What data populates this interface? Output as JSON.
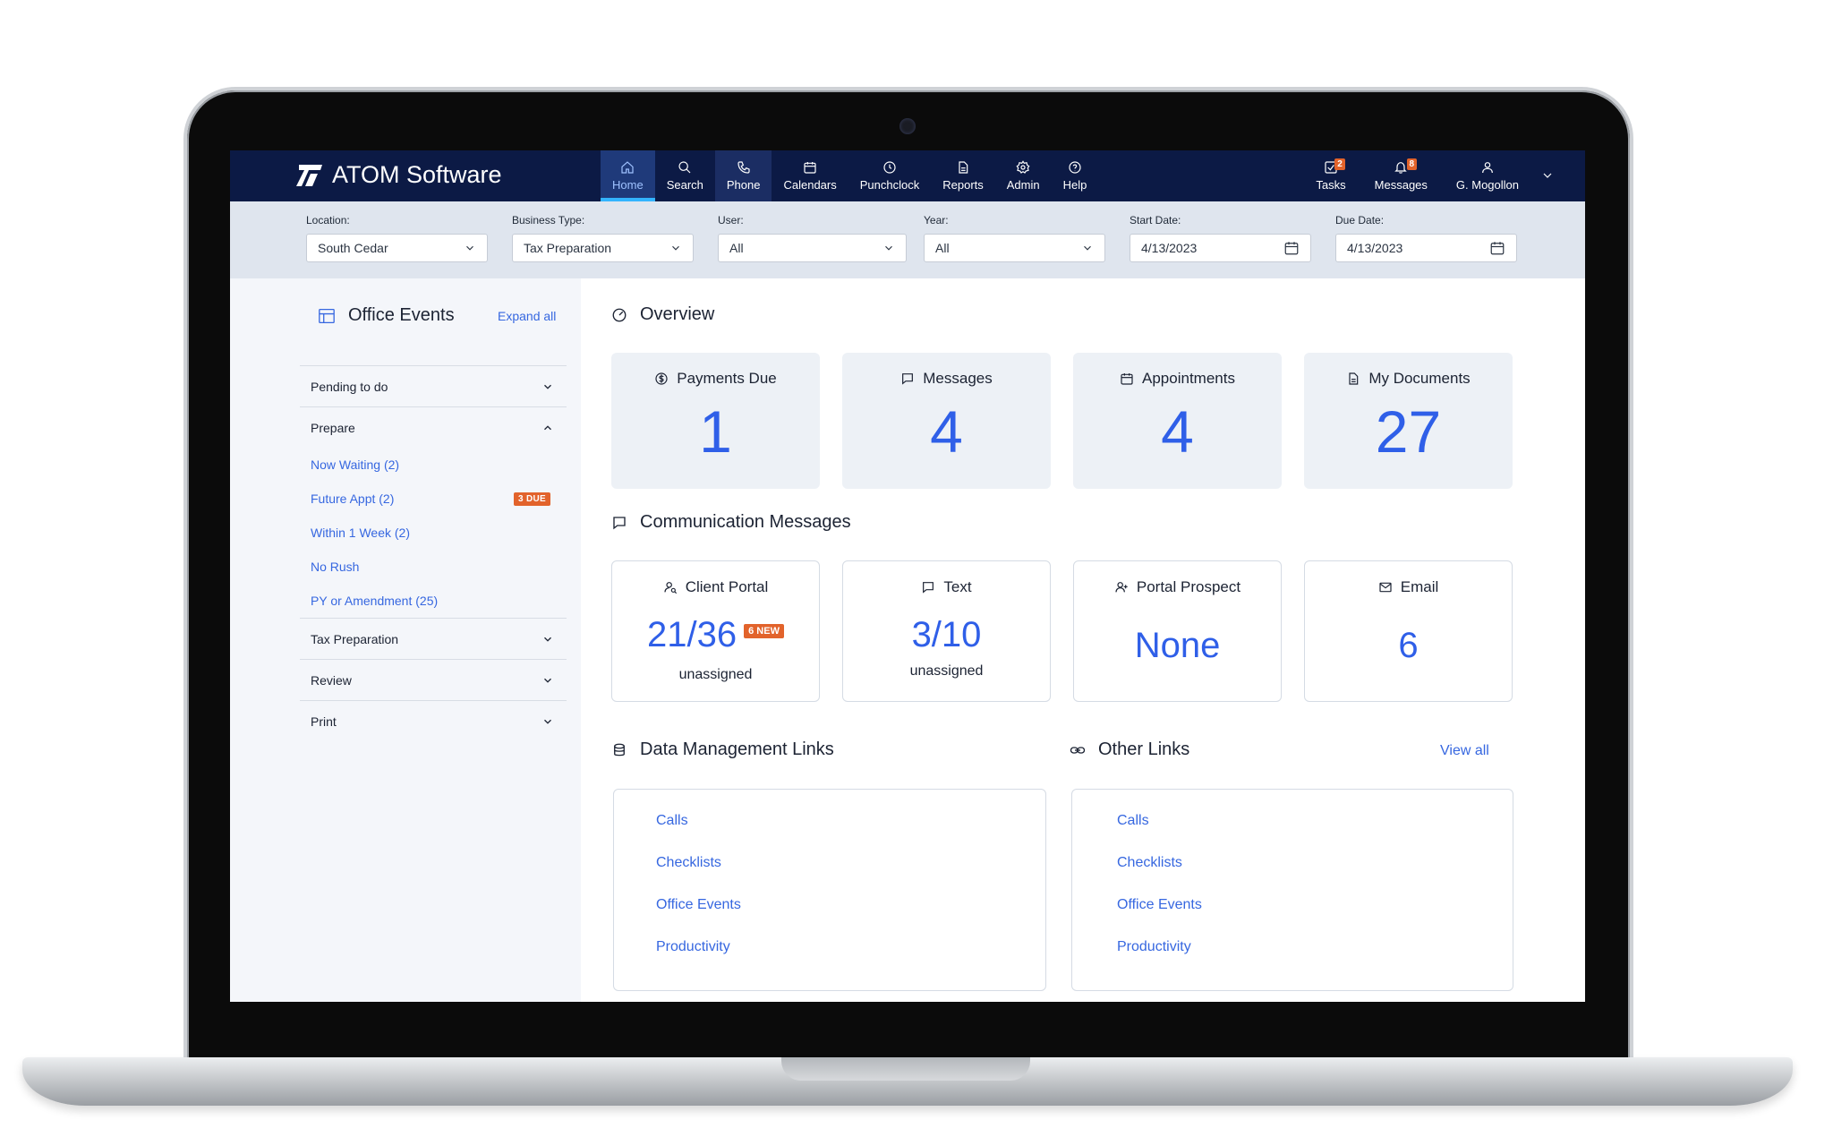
{
  "app": {
    "brand": "ATOM Software"
  },
  "nav": {
    "items": [
      {
        "label": "Home",
        "icon": "home-icon"
      },
      {
        "label": "Search",
        "icon": "search-icon"
      },
      {
        "label": "Phone",
        "icon": "phone-icon"
      },
      {
        "label": "Calendars",
        "icon": "calendar-icon"
      },
      {
        "label": "Punchclock",
        "icon": "clock-icon"
      },
      {
        "label": "Reports",
        "icon": "report-icon"
      },
      {
        "label": "Admin",
        "icon": "gear-icon"
      },
      {
        "label": "Help",
        "icon": "help-icon"
      }
    ],
    "right": {
      "tasks": {
        "label": "Tasks",
        "count": "2"
      },
      "messages": {
        "label": "Messages",
        "count": "8"
      },
      "user": {
        "label": "G. Mogollon"
      }
    }
  },
  "filters": {
    "location": {
      "label": "Location:",
      "value": "South Cedar"
    },
    "business_type": {
      "label": "Business Type:",
      "value": "Tax Preparation"
    },
    "user": {
      "label": "User:",
      "value": "All"
    },
    "year": {
      "label": "Year:",
      "value": "All"
    },
    "start_date": {
      "label": "Start Date:",
      "value": "4/13/2023"
    },
    "due_date": {
      "label": "Due Date:",
      "value": "4/13/2023"
    }
  },
  "office_events": {
    "title": "Office Events",
    "expand_all": "Expand all",
    "sections": {
      "pending": "Pending to do",
      "prepare": "Prepare",
      "tax_preparation": "Tax Preparation",
      "review": "Review",
      "print": "Print"
    },
    "prepare_items": [
      {
        "label": "Now Waiting (2)"
      },
      {
        "label": "Future Appt (2)",
        "badge": "3 DUE"
      },
      {
        "label": "Within 1 Week (2)"
      },
      {
        "label": "No Rush"
      },
      {
        "label": "PY or Amendment (25)"
      }
    ]
  },
  "overview": {
    "title": "Overview",
    "cards": [
      {
        "label": "Payments Due",
        "value": "1"
      },
      {
        "label": "Messages",
        "value": "4"
      },
      {
        "label": "Appointments",
        "value": "4"
      },
      {
        "label": "My Documents",
        "value": "27"
      }
    ]
  },
  "communication": {
    "title": "Communication Messages",
    "client_portal": {
      "label": "Client Portal",
      "value": "21/36",
      "badge": "6 NEW",
      "sub": "unassigned"
    },
    "text": {
      "label": "Text",
      "value": "3/10",
      "sub": "unassigned"
    },
    "portal_prospect": {
      "label": "Portal Prospect",
      "value": "None"
    },
    "email": {
      "label": "Email",
      "value": "6"
    }
  },
  "data_links": {
    "title": "Data Management Links",
    "items": [
      "Calls",
      "Checklists",
      "Office Events",
      "Productivity"
    ]
  },
  "other_links": {
    "title": "Other Links",
    "view_all": "View all",
    "items": [
      "Calls",
      "Checklists",
      "Office Events",
      "Productivity"
    ]
  },
  "colors": {
    "nav_bg": "#0c1a45",
    "accent": "#2f5fe8",
    "badge": "#e2632b"
  }
}
